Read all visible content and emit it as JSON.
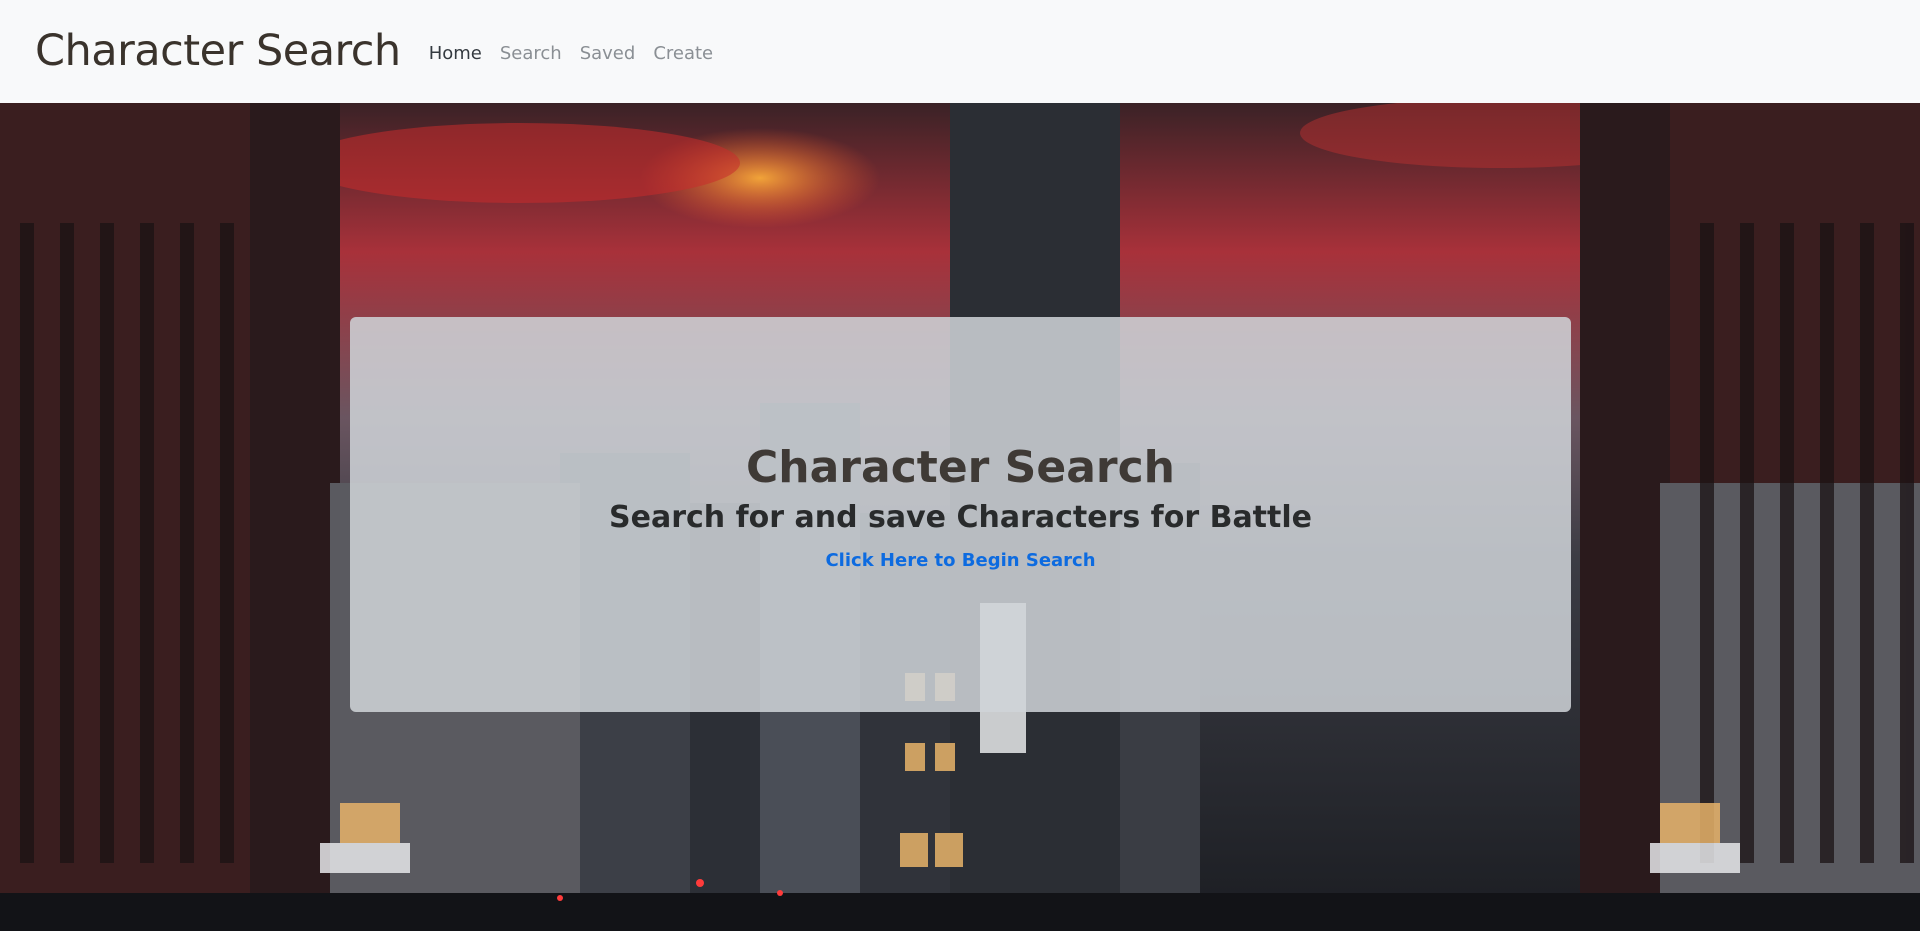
{
  "navbar": {
    "brand": "Character Search",
    "links": [
      {
        "label": "Home",
        "active": true
      },
      {
        "label": "Search",
        "active": false
      },
      {
        "label": "Saved",
        "active": false
      },
      {
        "label": "Create",
        "active": false
      }
    ]
  },
  "hero": {
    "title": "Character Search",
    "subtitle": "Search for and save Characters for Battle",
    "cta_label": "Click Here to Begin Search"
  },
  "colors": {
    "navbar_bg": "#f8f9fa",
    "link_accent": "#0d6be0",
    "jumbotron_bg": "rgba(207,212,216,0.86)"
  }
}
